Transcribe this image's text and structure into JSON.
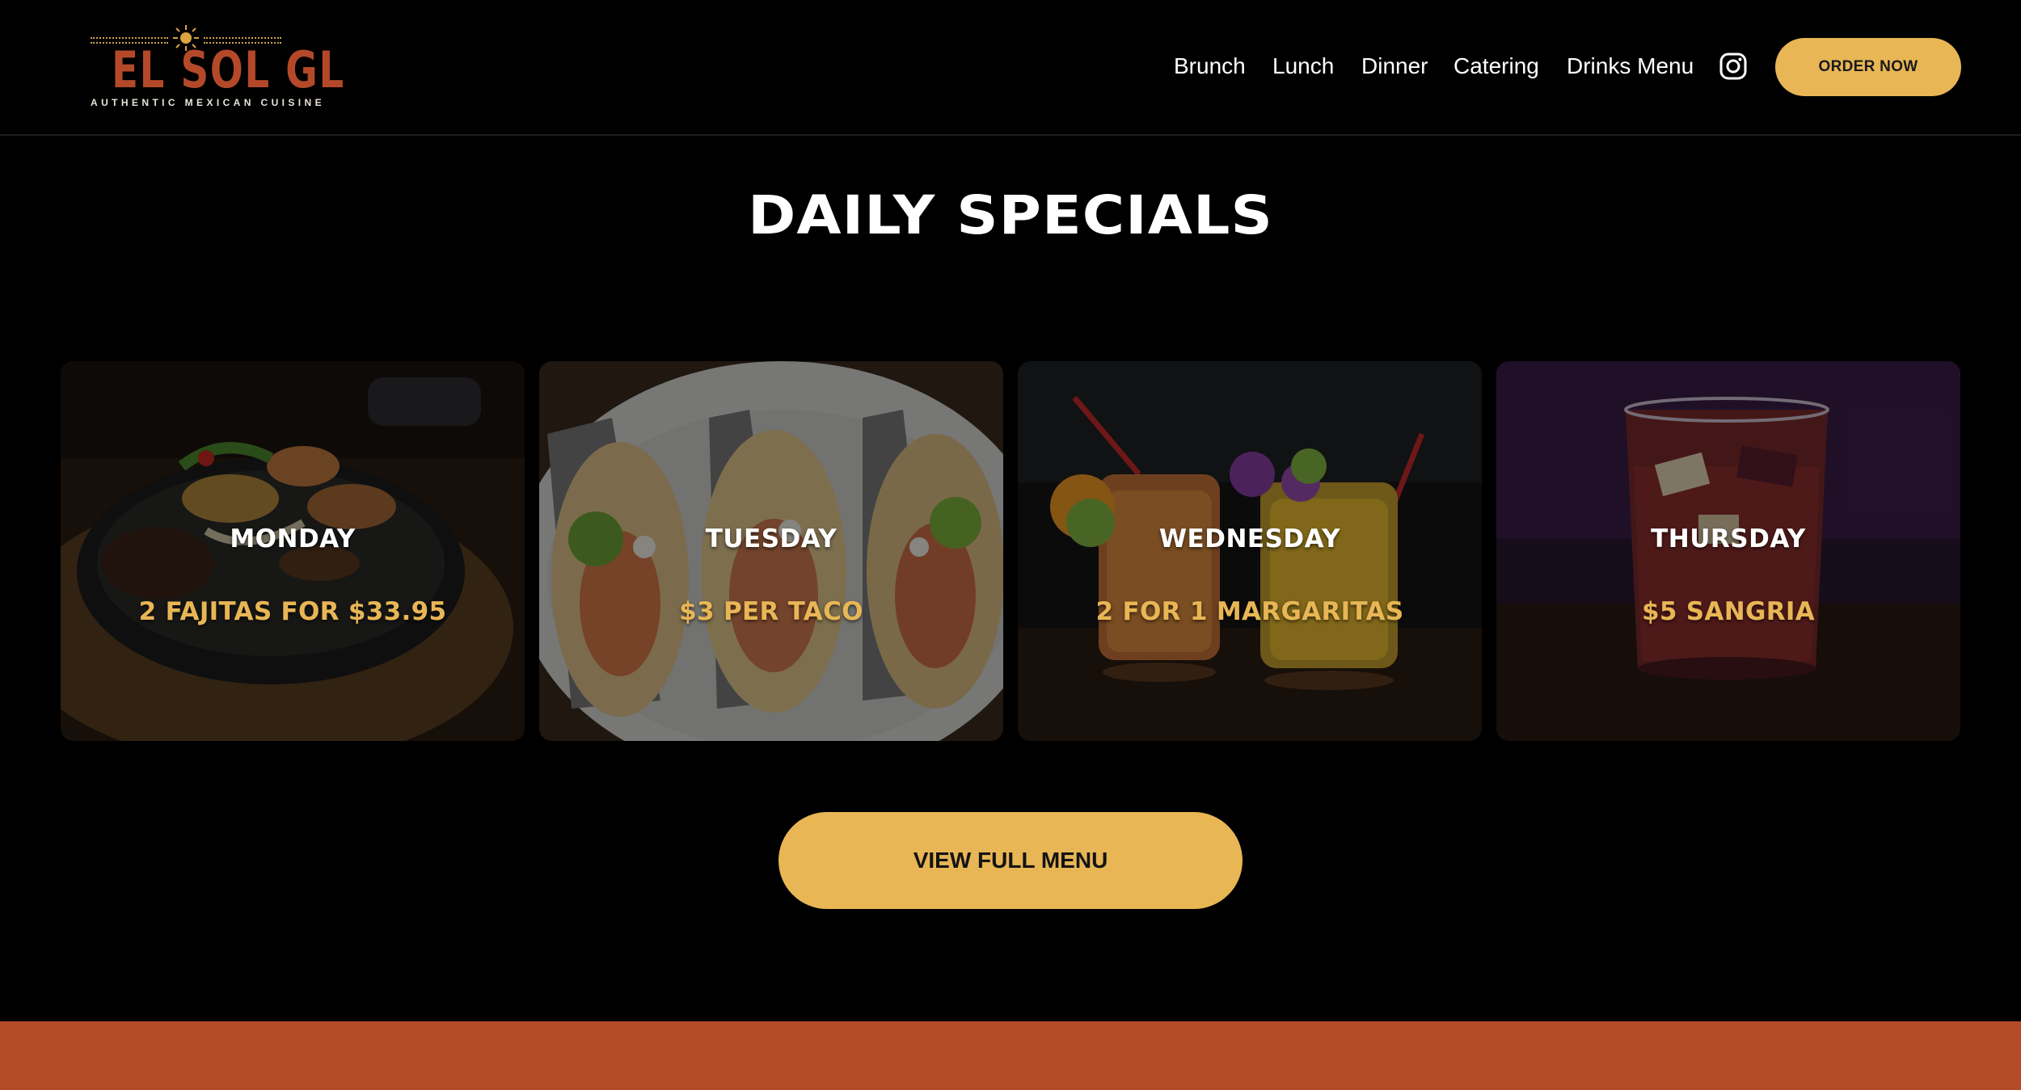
{
  "brand": {
    "name": "EL SOL GL",
    "tagline": "AUTHENTIC MEXICAN CUISINE",
    "colors": {
      "accent": "#e8b655",
      "brand": "#b4492a",
      "footer": "#b34a28",
      "background": "#000000"
    }
  },
  "nav": {
    "items": [
      "Brunch",
      "Lunch",
      "Dinner",
      "Catering",
      "Drinks Menu"
    ],
    "instagram_icon": "instagram-icon",
    "order_label": "ORDER NOW"
  },
  "specials": {
    "title": "DAILY SPECIALS",
    "cards": [
      {
        "day": "MONDAY",
        "deal": "2 FAJITAS FOR $33.95",
        "image": "fajitas-skillet"
      },
      {
        "day": "TUESDAY",
        "deal": "$3 PER TACO",
        "image": "tacos-plate"
      },
      {
        "day": "WEDNESDAY",
        "deal": "2 FOR 1 MARGARITAS",
        "image": "margaritas"
      },
      {
        "day": "THURSDAY",
        "deal": "$5 SANGRIA",
        "image": "sangria-glass"
      }
    ],
    "menu_button": "VIEW FULL MENU"
  }
}
